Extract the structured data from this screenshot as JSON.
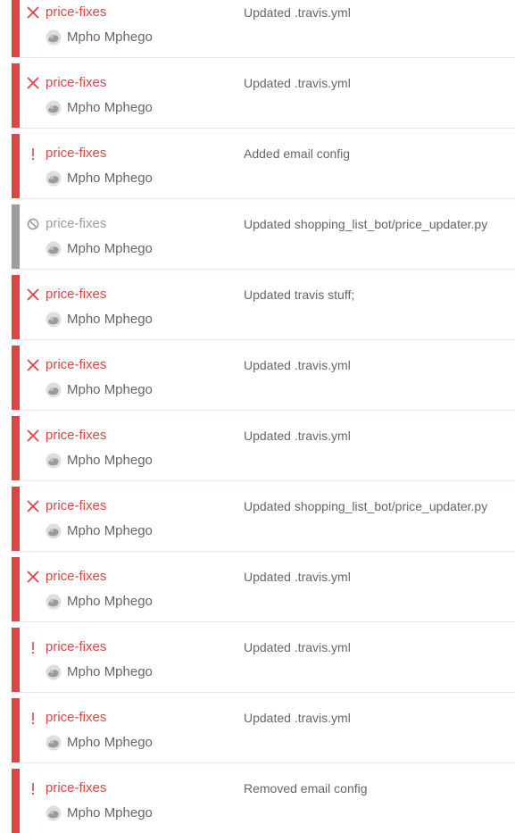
{
  "colors": {
    "failed": "#db4545",
    "errored": "#db4545",
    "canceled": "#9d9d9d",
    "text_muted": "#666666"
  },
  "builds": [
    {
      "status": "failed",
      "status_icon": "x-icon",
      "branch": "price-fixes",
      "author": "Mpho Mphego",
      "message": "Updated .travis.yml"
    },
    {
      "status": "failed",
      "status_icon": "x-icon",
      "branch": "price-fixes",
      "author": "Mpho Mphego",
      "message": "Updated .travis.yml"
    },
    {
      "status": "errored",
      "status_icon": "exclamation-icon",
      "branch": "price-fixes",
      "author": "Mpho Mphego",
      "message": "Added email config"
    },
    {
      "status": "canceled",
      "status_icon": "canceled-icon",
      "branch": "price-fixes",
      "author": "Mpho Mphego",
      "message": "Updated shopping_list_bot/price_updater.py"
    },
    {
      "status": "failed",
      "status_icon": "x-icon",
      "branch": "price-fixes",
      "author": "Mpho Mphego",
      "message": "Updated travis stuff;"
    },
    {
      "status": "failed",
      "status_icon": "x-icon",
      "branch": "price-fixes",
      "author": "Mpho Mphego",
      "message": "Updated .travis.yml"
    },
    {
      "status": "failed",
      "status_icon": "x-icon",
      "branch": "price-fixes",
      "author": "Mpho Mphego",
      "message": "Updated .travis.yml"
    },
    {
      "status": "failed",
      "status_icon": "x-icon",
      "branch": "price-fixes",
      "author": "Mpho Mphego",
      "message": "Updated shopping_list_bot/price_updater.py"
    },
    {
      "status": "failed",
      "status_icon": "x-icon",
      "branch": "price-fixes",
      "author": "Mpho Mphego",
      "message": "Updated .travis.yml"
    },
    {
      "status": "errored",
      "status_icon": "exclamation-icon",
      "branch": "price-fixes",
      "author": "Mpho Mphego",
      "message": "Updated .travis.yml"
    },
    {
      "status": "errored",
      "status_icon": "exclamation-icon",
      "branch": "price-fixes",
      "author": "Mpho Mphego",
      "message": "Updated .travis.yml"
    },
    {
      "status": "errored",
      "status_icon": "exclamation-icon",
      "branch": "price-fixes",
      "author": "Mpho Mphego",
      "message": "Removed email config"
    }
  ]
}
